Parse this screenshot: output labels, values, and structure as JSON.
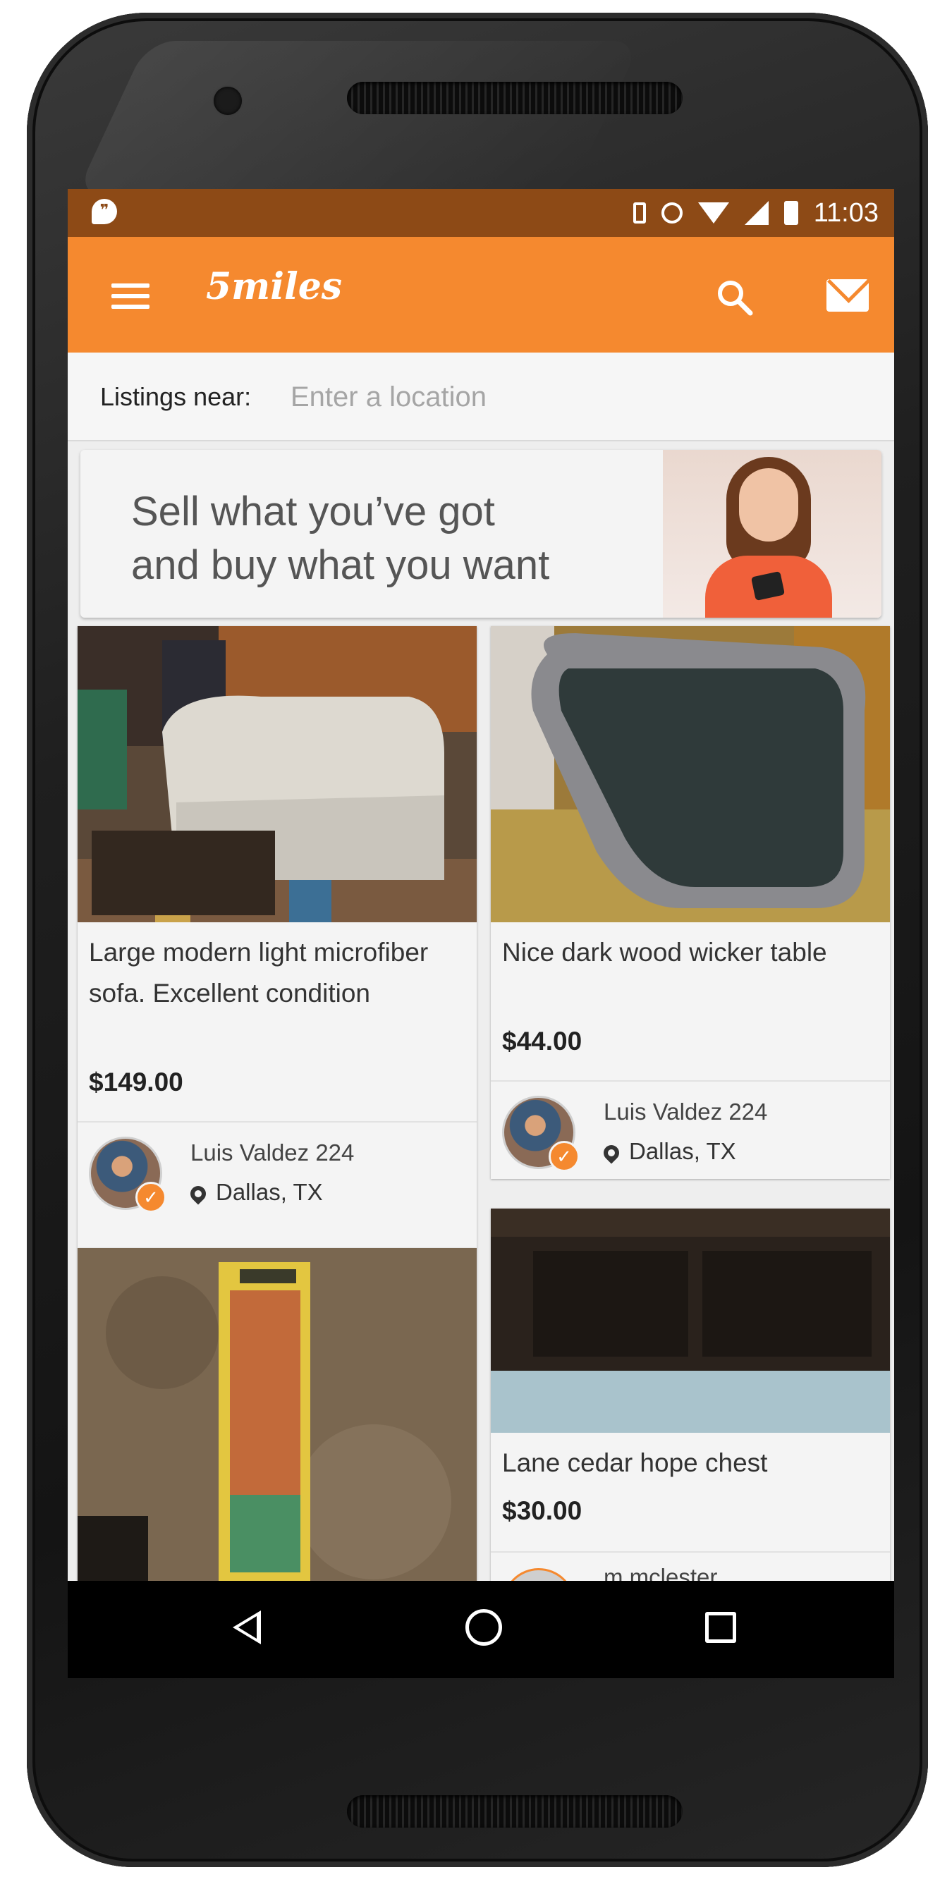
{
  "status_bar": {
    "time": "11:03"
  },
  "app_bar": {
    "logo": "5miles"
  },
  "location": {
    "label": "Listings near:",
    "placeholder": "Enter a location"
  },
  "banner": {
    "text": "Sell what you’ve got\nand buy what you want"
  },
  "listings": [
    {
      "title": "Large modern light microfiber sofa. Excellent condition",
      "price": "$149.00",
      "seller": "Luis Valdez 224",
      "city": "Dallas, TX"
    },
    {
      "title": "Nice dark wood wicker table",
      "price": "$44.00",
      "seller": "Luis Valdez 224",
      "city": "Dallas, TX"
    },
    {
      "title": "Lane cedar hope chest",
      "price": "$30.00",
      "seller": "m mclester"
    }
  ],
  "colors": {
    "accent": "#f5892f",
    "status_bar": "#8d4a16"
  },
  "icons": [
    "hangouts-icon",
    "vibrate-icon",
    "alarm-icon",
    "wifi-icon",
    "signal-icon",
    "battery-icon",
    "menu-icon",
    "search-icon",
    "mail-icon",
    "location-pin-icon",
    "verified-icon",
    "back-icon",
    "home-icon",
    "recents-icon"
  ]
}
